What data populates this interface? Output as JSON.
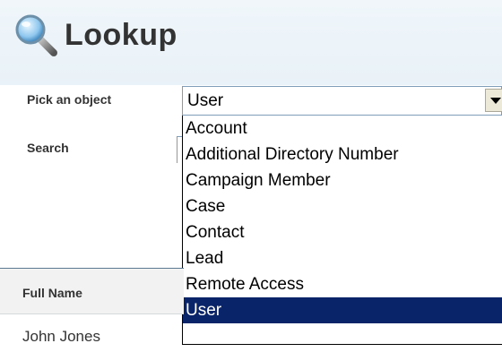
{
  "header": {
    "title": "Lookup",
    "icon": "magnifier-icon"
  },
  "form": {
    "pick_label": "Pick an object",
    "search_label": "Search",
    "selected_object": "User",
    "options": [
      "Account",
      "Additional Directory Number",
      "Campaign Member",
      "Case",
      "Contact",
      "Lead",
      "Remote Access",
      "User"
    ],
    "highlighted_option": "User"
  },
  "results": {
    "columns": [
      "Full Name"
    ],
    "rows": [
      [
        "John Jones"
      ]
    ]
  },
  "colors": {
    "highlight": "#0a246a",
    "header_band": "#eef5fa",
    "text": "#333333"
  }
}
